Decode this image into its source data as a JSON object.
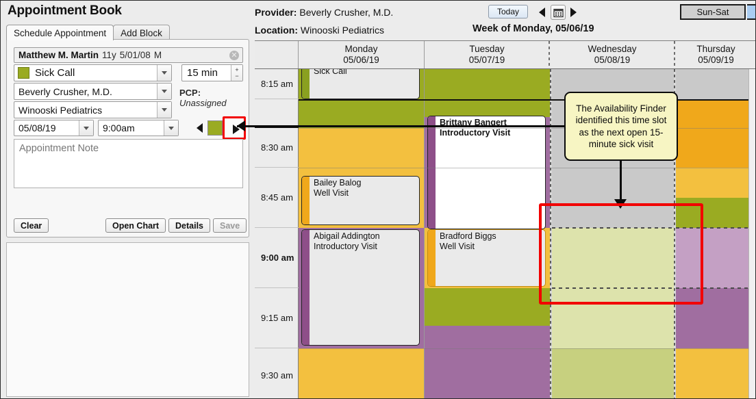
{
  "app": {
    "title": "Appointment Book"
  },
  "tabs": [
    {
      "label": "Schedule Appointment",
      "active": true
    },
    {
      "label": "Add Block",
      "active": false
    }
  ],
  "form": {
    "patient": {
      "name": "Matthew M. Martin",
      "age": "11y",
      "dob": "5/01/08",
      "sex": "M",
      "clear_icon": "clear-circle-icon"
    },
    "visit_type": {
      "value": "Sick Call",
      "swatch_color": "#9aab22"
    },
    "duration": {
      "value": "15 min",
      "plus": "+",
      "minus": "−"
    },
    "provider": {
      "value": "Beverly Crusher, M.D."
    },
    "pcp": {
      "label": "PCP:",
      "value": "Unassigned"
    },
    "location": {
      "value": "Winooski Pediatrics"
    },
    "date": {
      "value": "05/08/19"
    },
    "time": {
      "value": "9:00am"
    },
    "availability_finder": {
      "prev_icon": "triangle-left-icon",
      "next_icon": "triangle-right-icon",
      "swatch_color": "#9aab22",
      "highlight_color": "#f20000"
    },
    "note": {
      "placeholder": "Appointment Note",
      "value": ""
    },
    "buttons": {
      "clear": "Clear",
      "open_chart": "Open Chart",
      "details": "Details",
      "save": "Save"
    }
  },
  "header": {
    "provider_label": "Provider:",
    "provider_value": "Beverly Crusher, M.D.",
    "location_label": "Location:",
    "location_value": "Winooski Pediatrics",
    "today_button": "Today",
    "prev_icon": "triangle-left-icon",
    "calendar_icon": "calendar-icon",
    "next_icon": "triangle-right-icon",
    "week_label": "Week of Monday, 05/06/19",
    "range_select": "Sun-Sat"
  },
  "calendar": {
    "columns": [
      {
        "day": "Monday",
        "date": "05/06/19"
      },
      {
        "day": "Tuesday",
        "date": "05/07/19"
      },
      {
        "day": "Wednesday",
        "date": "05/08/19"
      },
      {
        "day": "Thursday",
        "date": "05/09/19"
      }
    ],
    "times": [
      {
        "label": "8:15 am",
        "bold": false
      },
      {
        "label": "8:30 am",
        "bold": false
      },
      {
        "label": "8:45 am",
        "bold": false
      },
      {
        "label": "9:00 am",
        "bold": true
      },
      {
        "label": "9:15 am",
        "bold": false
      },
      {
        "label": "9:30 am",
        "bold": false
      }
    ],
    "appointments": [
      {
        "col": "Monday",
        "patient": "",
        "visit": "Sick Call",
        "bar_color": "#8aa020",
        "selected": false
      },
      {
        "col": "Monday",
        "patient": "Bailey Balog",
        "visit": "Well Visit",
        "bar_color": "#f0a81b",
        "selected": false
      },
      {
        "col": "Monday",
        "patient": "Abigail Addington",
        "visit": "Introductory Visit",
        "bar_color": "#8e4f89",
        "selected": false
      },
      {
        "col": "Tuesday",
        "patient": "Brittany Bangert",
        "visit": "Introductory Visit",
        "bar_color": "#8e4f89",
        "selected": true
      },
      {
        "col": "Tuesday",
        "patient": "Bradford Biggs",
        "visit": "Well Visit",
        "bar_color": "#f0a81b",
        "selected": false
      }
    ],
    "legend_colors": {
      "sick_call": "#9aab22",
      "well_visit": "#f3c03f",
      "introductory_visit": "#a06ea0",
      "unavailable": "#c9c9c9",
      "open_slot": "#dde3ac"
    }
  },
  "callout": {
    "text": "The Availability Finder identified this time slot as the next open 15-minute sick visit",
    "background": "#f7f5c3",
    "arrow_icon": "down-arrow-icon",
    "highlight_box_color": "#f20000"
  }
}
